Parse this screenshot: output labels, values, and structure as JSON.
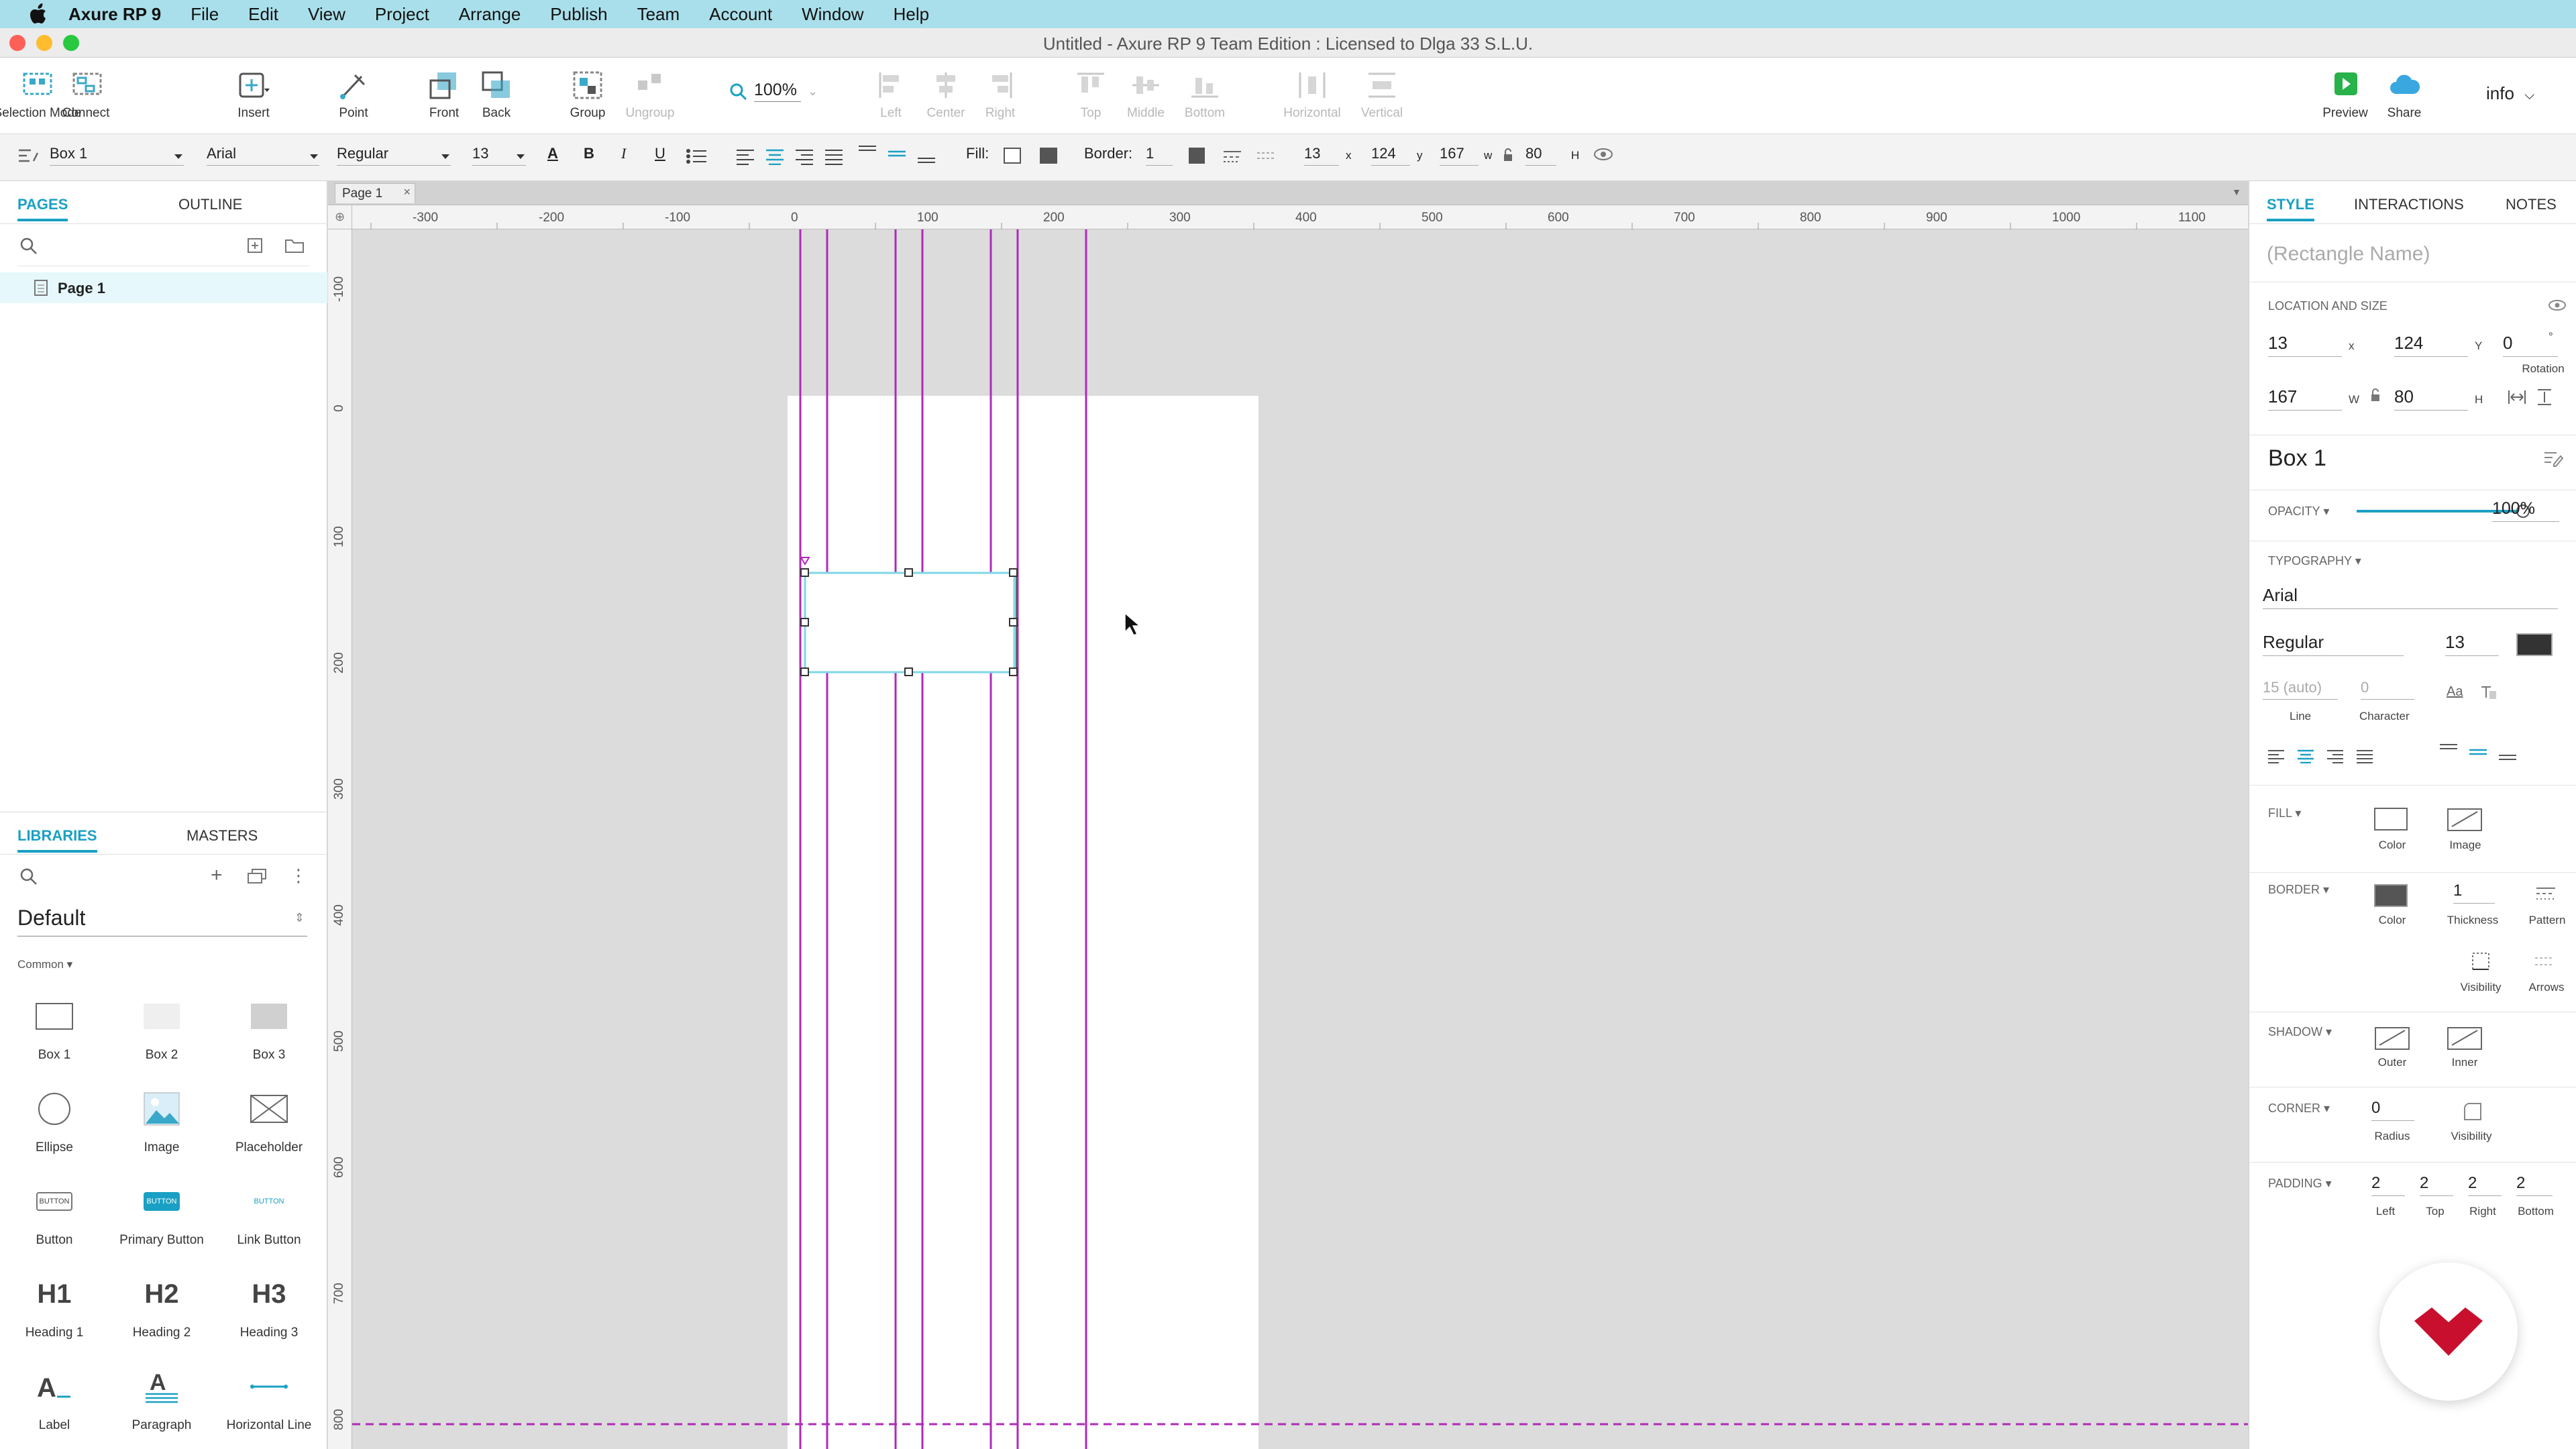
{
  "menubar": {
    "app": "Axure RP 9",
    "items": [
      "File",
      "Edit",
      "View",
      "Project",
      "Arrange",
      "Publish",
      "Team",
      "Account",
      "Window",
      "Help"
    ]
  },
  "window": {
    "title": "Untitled - Axure RP 9 Team Edition : Licensed to Dlga 33 S.L.U."
  },
  "toolbar": {
    "selection_mode": "Selection Mode",
    "connect": "Connect",
    "insert": "Insert",
    "point": "Point",
    "front": "Front",
    "back": "Back",
    "group": "Group",
    "ungroup": "Ungroup",
    "zoom": "100%",
    "left": "Left",
    "center": "Center",
    "right": "Right",
    "top": "Top",
    "middle": "Middle",
    "bottom": "Bottom",
    "horizontal": "Horizontal",
    "vertical": "Vertical",
    "preview": "Preview",
    "share": "Share",
    "info": "info"
  },
  "formatbar": {
    "widget_name": "Box 1",
    "font": "Arial",
    "style": "Regular",
    "size": "13",
    "fill_label": "Fill:",
    "border_label": "Border:",
    "border_value": "1",
    "x": "13",
    "x_label": "x",
    "y": "124",
    "y_label": "y",
    "w": "167",
    "w_label": "w",
    "h": "80",
    "h_label": "H"
  },
  "pages": {
    "tab_pages": "PAGES",
    "tab_outline": "OUTLINE",
    "items": [
      "Page 1"
    ]
  },
  "libraries": {
    "tab_libraries": "LIBRARIES",
    "tab_masters": "MASTERS",
    "selected": "Default",
    "category": "Common ▾",
    "widgets": [
      "Box 1",
      "Box 2",
      "Box 3",
      "Ellipse",
      "Image",
      "Placeholder",
      "Button",
      "Primary Button",
      "Link Button",
      "Heading 1",
      "Heading 2",
      "Heading 3",
      "Label",
      "Paragraph",
      "Horizontal Line"
    ],
    "button_text": "BUTTON",
    "h1": "H1",
    "h2": "H2",
    "h3": "H3"
  },
  "canvas": {
    "page_tab": "Page 1",
    "hruler": [
      "-300",
      "-200",
      "-100",
      "0",
      "100",
      "200",
      "300",
      "400",
      "500",
      "600",
      "700",
      "800",
      "900",
      "1000",
      "1100"
    ],
    "vruler": [
      "-100",
      "0",
      "100",
      "200",
      "300",
      "400",
      "500",
      "600",
      "700",
      "800"
    ]
  },
  "style_panel": {
    "tab_style": "STYLE",
    "tab_interactions": "INTERACTIONS",
    "tab_notes": "NOTES",
    "name_placeholder": "(Rectangle Name)",
    "location_size": "LOCATION AND SIZE",
    "x": "13",
    "x_label": "x",
    "y": "124",
    "y_label": "Y",
    "rotation": "0",
    "rotation_unit": "°",
    "rotation_label": "Rotation",
    "w": "167",
    "w_label": "W",
    "h": "80",
    "h_label": "H",
    "style_name": "Box 1",
    "opacity_label": "OPACITY ▾",
    "opacity": "100%",
    "opacity_level": 1.0,
    "typography_label": "TYPOGRAPHY ▾",
    "font": "Arial",
    "font_style": "Regular",
    "font_size": "13",
    "line": "15 (auto)",
    "line_label": "Line",
    "character": "0",
    "character_label": "Character",
    "fill_label": "FILL ▾",
    "fill_color": "Color",
    "fill_image": "Image",
    "border_label": "BORDER ▾",
    "border_color": "Color",
    "border_thickness": "1",
    "thickness_label": "Thickness",
    "pattern_label": "Pattern",
    "visibility_label": "Visibility",
    "arrows_label": "Arrows",
    "shadow_label": "SHADOW ▾",
    "outer": "Outer",
    "inner": "Inner",
    "corner_label": "CORNER ▾",
    "radius": "0",
    "radius_label": "Radius",
    "corner_visibility": "Visibility",
    "padding_label": "PADDING ▾",
    "padding": [
      {
        "value": "2",
        "label": "Left"
      },
      {
        "value": "2",
        "label": "Top"
      },
      {
        "value": "2",
        "label": "Right"
      },
      {
        "value": "2",
        "label": "Bottom"
      }
    ]
  },
  "colors": {
    "accent": "#1aa0c4",
    "guide": "#b02ab8",
    "logo": "#c8102e"
  }
}
